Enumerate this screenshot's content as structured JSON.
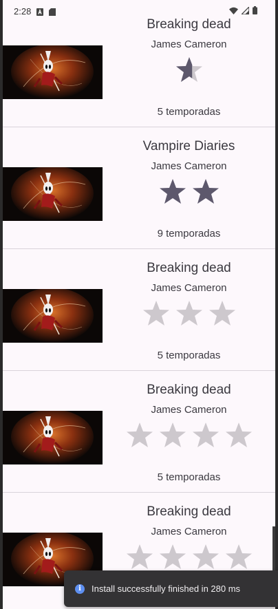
{
  "status_bar": {
    "time": "2:28",
    "icons": [
      "a-icon",
      "sd-card-icon",
      "wifi-icon",
      "signal-icon",
      "battery-icon"
    ]
  },
  "colors": {
    "star_filled": "#5d586c",
    "star_empty": "#cdc8cd"
  },
  "shows": [
    {
      "title": "Breaking dead",
      "author": "James Cameron",
      "rating": 0.6,
      "star_slots": 1,
      "seasons": "5 temporadas"
    },
    {
      "title": "Vampire Diaries",
      "author": "James Cameron",
      "rating": 2,
      "star_slots": 2,
      "seasons": "9 temporadas"
    },
    {
      "title": "Breaking dead",
      "author": "James Cameron",
      "rating": 0,
      "star_slots": 3,
      "seasons": "5 temporadas"
    },
    {
      "title": "Breaking dead",
      "author": "James Cameron",
      "rating": 0,
      "star_slots": 4,
      "seasons": "5 temporadas"
    },
    {
      "title": "Breaking dead",
      "author": "James Cameron",
      "rating": 0,
      "star_slots": 4,
      "seasons": "5 temporadas"
    }
  ],
  "toast": {
    "icon": "info-icon",
    "message": "Install successfully finished in 280 ms"
  }
}
